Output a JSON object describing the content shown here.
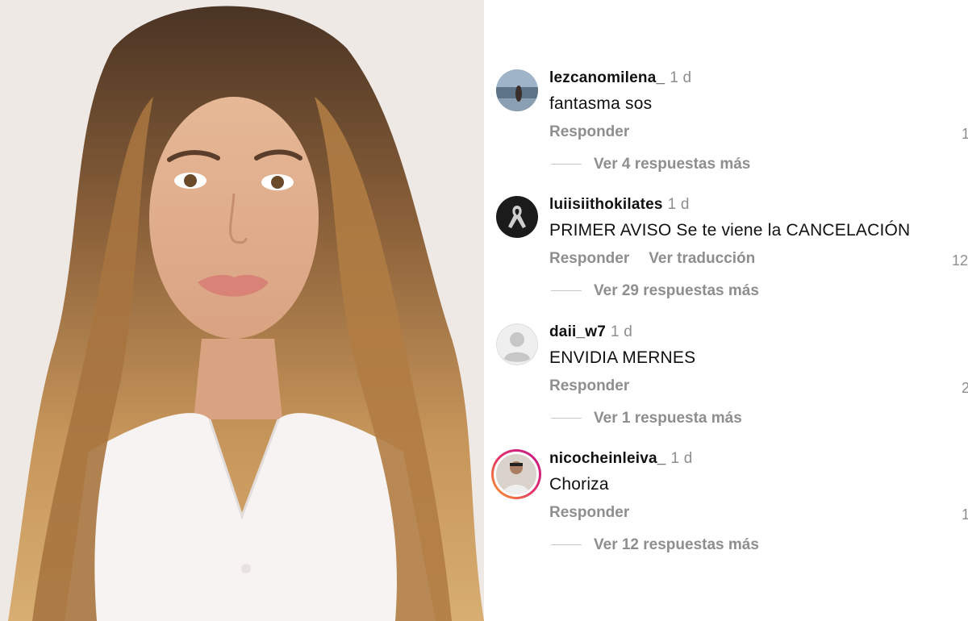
{
  "photo": {
    "subject": "portrait photo of a woman with long wavy hair"
  },
  "comments": [
    {
      "username": "lezcanomilena_",
      "time": "1 d",
      "text": "fantasma sos",
      "actions": [
        "Responder"
      ],
      "likes": "1",
      "replies": "Ver 4 respuestas más",
      "avatar": "photo-avatar-icon"
    },
    {
      "username": "luiisiithokilates",
      "time": "1 d",
      "text": "PRIMER AVISO Se te viene  la CANCELACIÓN",
      "actions": [
        "Responder",
        "Ver traducción"
      ],
      "likes": "12,",
      "replies": "Ver 29 respuestas más",
      "avatar": "mourning-ribbon-icon"
    },
    {
      "username": "daii_w7",
      "time": "1 d",
      "text": "ENVIDIA MERNES",
      "actions": [
        "Responder"
      ],
      "likes": "2",
      "replies": "Ver 1 respuesta más",
      "avatar": "default-user-icon"
    },
    {
      "username": "nicocheinleiva_",
      "time": "1 d",
      "text": "Choriza",
      "actions": [
        "Responder"
      ],
      "likes": "1",
      "replies": "Ver 12 respuestas más",
      "avatar": "story-ring-avatar-icon"
    }
  ],
  "colors": {
    "text": "#111111",
    "muted": "#8e8e8e",
    "story_ring_start": "#f9a423",
    "story_ring_end": "#c2188b"
  }
}
